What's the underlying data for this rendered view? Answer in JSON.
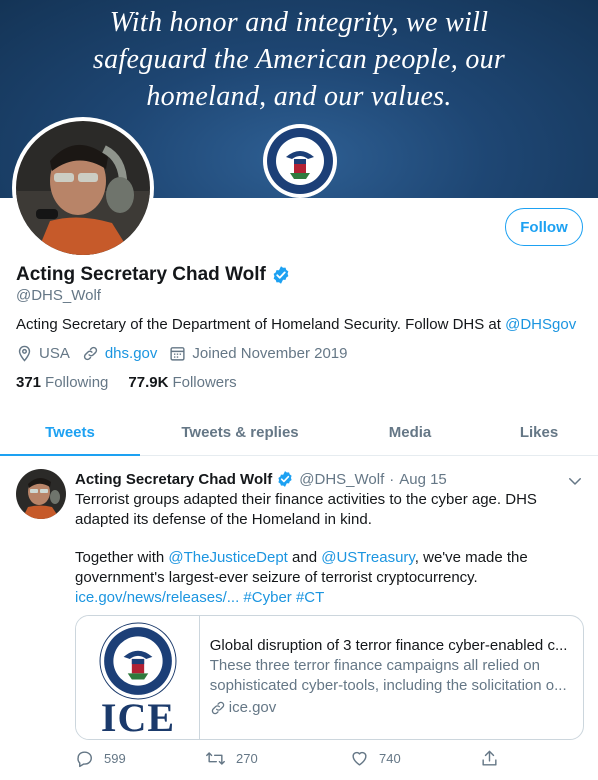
{
  "banner": {
    "lines": [
      "With honor and integrity, we will",
      "safeguard the American people, our",
      "homeland, and our values."
    ]
  },
  "profile": {
    "name": "Acting Secretary Chad Wolf",
    "handle": "@DHS_Wolf",
    "bio_text": "Acting Secretary of the Department of Homeland Security. Follow DHS at ",
    "bio_mention": "@DHSgov",
    "location": "USA",
    "website": "dhs.gov",
    "joined": "Joined November 2019",
    "following_count": "371",
    "following_label": "Following",
    "followers_count": "77.9K",
    "followers_label": "Followers",
    "follow_button": "Follow"
  },
  "tabs": [
    {
      "label": "Tweets",
      "active": true
    },
    {
      "label": "Tweets & replies",
      "active": false
    },
    {
      "label": "Media",
      "active": false
    },
    {
      "label": "Likes",
      "active": false
    }
  ],
  "tweet": {
    "name": "Acting Secretary Chad Wolf",
    "handle": "@DHS_Wolf",
    "dot": "·",
    "date": "Aug 15",
    "line1": "Terrorist groups adapted their finance activities to the cyber age. DHS",
    "line2": "adapted its defense of the Homeland in kind.",
    "line3_a": "Together with ",
    "line3_m1": "@TheJusticeDept",
    "line3_b": " and ",
    "line3_m2": "@USTreasury",
    "line3_c": ", we've made the",
    "line4": "government's largest-ever seizure of terrorist cryptocurrency.",
    "link": "ice.gov/news/releases/...",
    "tag1": "#Cyber",
    "tag2": "#CT",
    "card": {
      "logo_text": "ICE",
      "title": "Global disruption of 3 terror finance cyber-enabled c...",
      "desc1": "These three terror finance campaigns all relied on",
      "desc2": "sophisticated cyber-tools, including the solicitation o...",
      "domain": "ice.gov"
    },
    "replies": "599",
    "retweets": "270",
    "likes": "740"
  },
  "colors": {
    "accent": "#1da1f2",
    "link": "#1b95e0",
    "muted": "#657786",
    "banner": "#1e4673"
  }
}
